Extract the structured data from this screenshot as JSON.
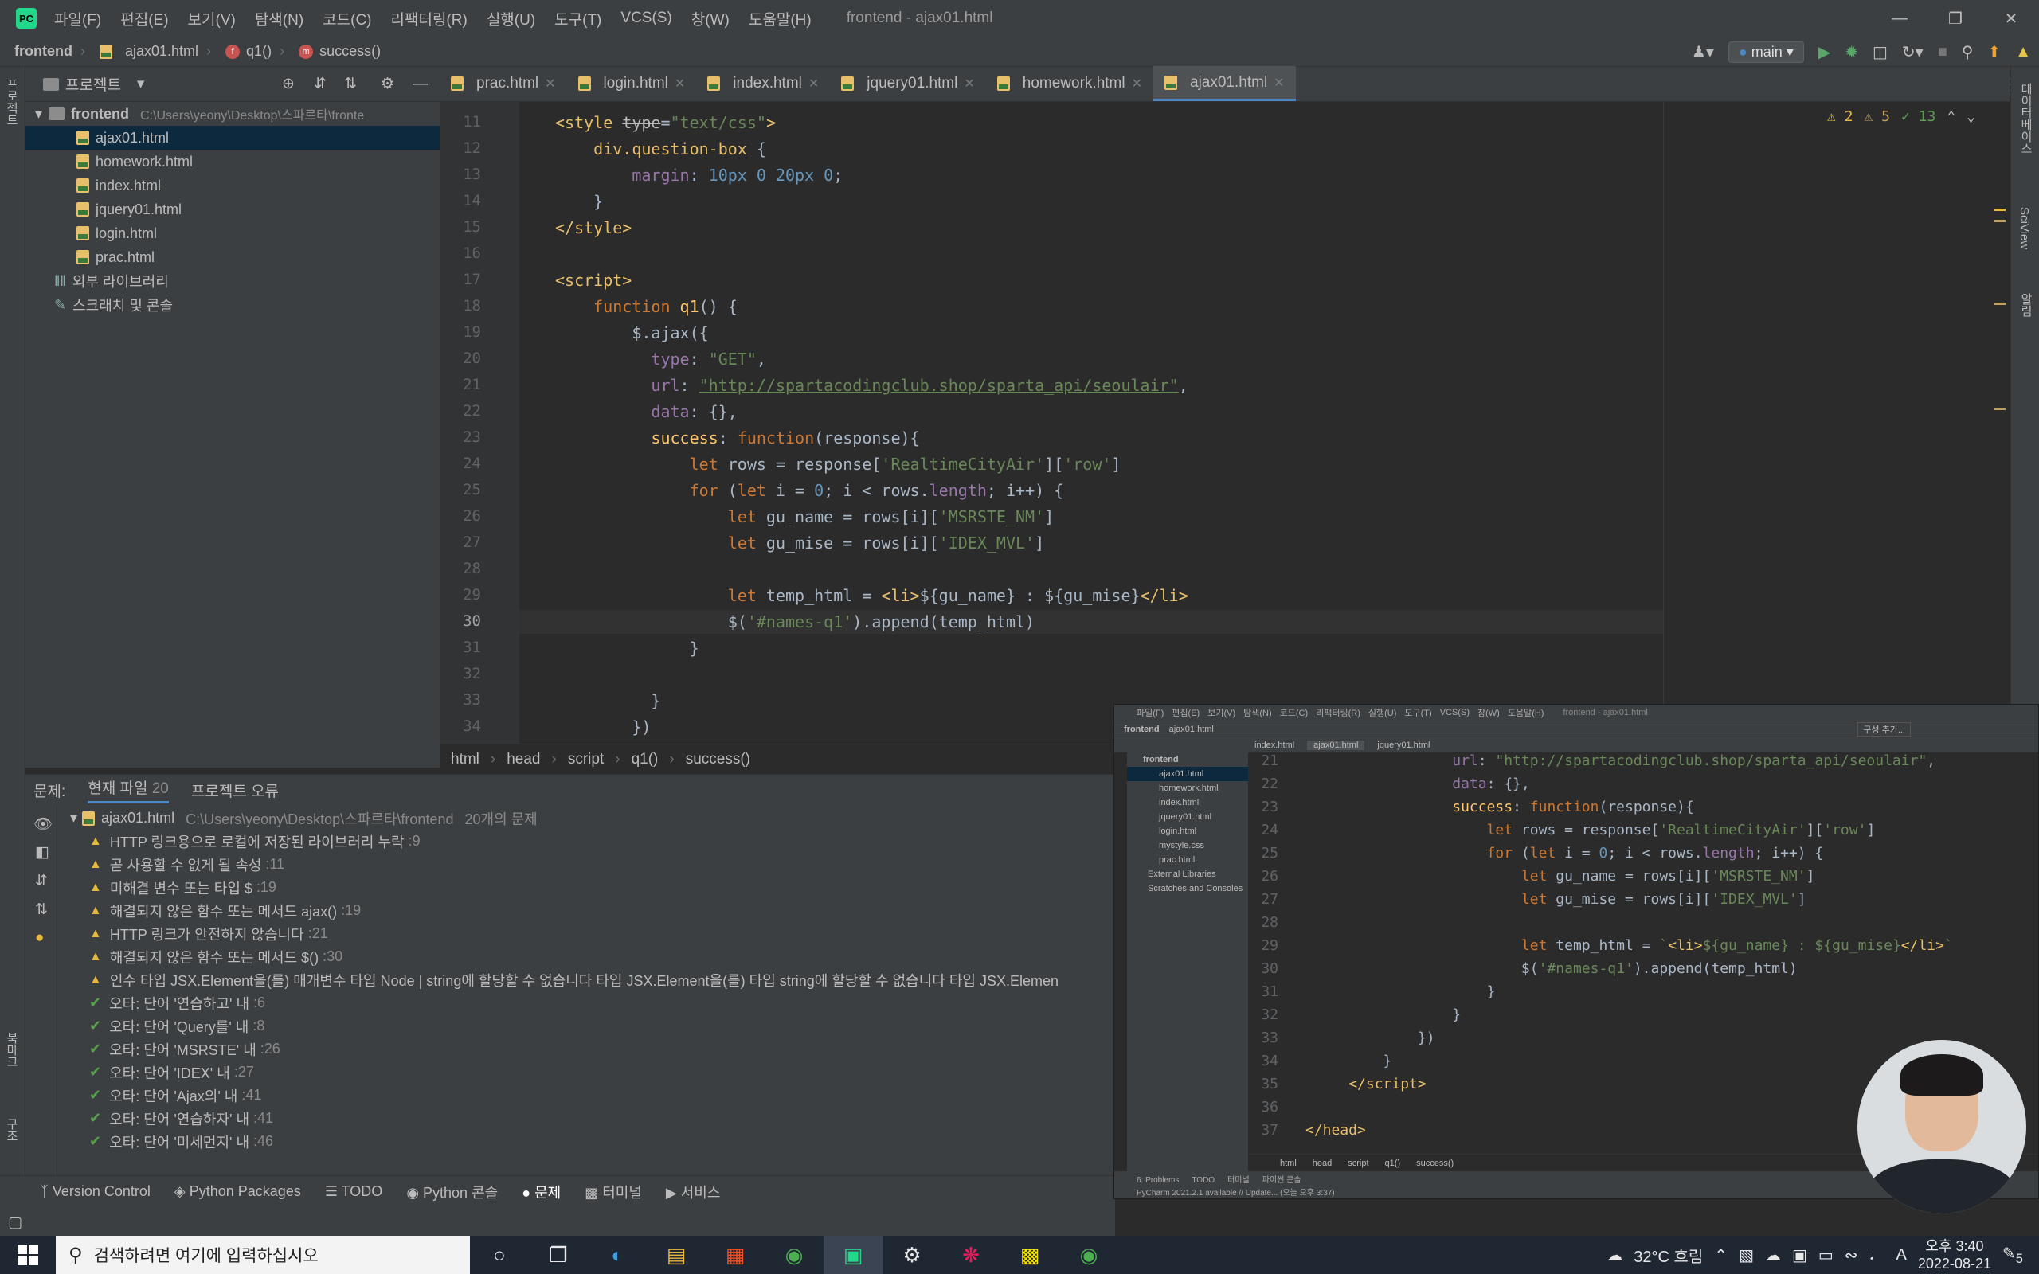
{
  "titlebar": {
    "menus": [
      "파일(F)",
      "편집(E)",
      "보기(V)",
      "탐색(N)",
      "코드(C)",
      "리팩터링(R)",
      "실행(U)",
      "도구(T)",
      "VCS(S)",
      "창(W)",
      "도움말(H)"
    ],
    "window_title": "frontend - ajax01.html",
    "app_logo": "PC"
  },
  "navbar": {
    "project": "frontend",
    "file": "ajax01.html",
    "fn1": "q1()",
    "fn2": "success()",
    "branch": "main"
  },
  "stripe": {
    "left_top": "프로젝트",
    "left_b1": "북마크",
    "left_b2": "구조",
    "right1": "데이터베이스",
    "right2": "SciView",
    "right3": "알림"
  },
  "project_panel": {
    "title": "프로젝트",
    "root": "frontend",
    "root_path": "C:\\Users\\yeony\\Desktop\\스파르타\\fronte",
    "files": [
      "ajax01.html",
      "homework.html",
      "index.html",
      "jquery01.html",
      "login.html",
      "prac.html"
    ],
    "ext_libs": "외부 라이브러리",
    "scratches": "스크래치 및 콘솔"
  },
  "tabs": [
    "prac.html",
    "login.html",
    "index.html",
    "jquery01.html",
    "homework.html",
    "ajax01.html"
  ],
  "editor": {
    "warnings": "2",
    "weak": "5",
    "typos": "13"
  },
  "breadcrumb": [
    "html",
    "head",
    "script",
    "q1()",
    "success()"
  ],
  "problems": {
    "label": "문제:",
    "tab_current": "현재 파일",
    "tab_current_count": "20",
    "tab_project": "프로젝트 오류",
    "file": "ajax01.html",
    "file_path": "C:\\Users\\yeony\\Desktop\\스파르타\\frontend",
    "file_count": "20개의 문제",
    "items": [
      {
        "t": "w",
        "text": "HTTP 링크용으로 로컬에 저장된 라이브러리 누락",
        "loc": ":9"
      },
      {
        "t": "w",
        "text": "곧 사용할 수 없게 될 속성",
        "loc": ":11"
      },
      {
        "t": "w",
        "text": "미해결 변수 또는 타입 $",
        "loc": ":19"
      },
      {
        "t": "w",
        "text": "해결되지 않은 함수 또는 메서드 ajax()",
        "loc": ":19"
      },
      {
        "t": "w",
        "text": "HTTP 링크가 안전하지 않습니다",
        "loc": ":21"
      },
      {
        "t": "w",
        "text": "해결되지 않은 함수 또는 메서드 $()",
        "loc": ":30"
      },
      {
        "t": "w",
        "text": "인수 타입 JSX.Element을(를) 매개변수 타입 Node | string에 할당할 수 없습니다  타입 JSX.Element을(를) 타입 string에 할당할 수 없습니다    타입 JSX.Elemen",
        "loc": ""
      },
      {
        "t": "t",
        "text": "오타: 단어 '연습하고' 내",
        "loc": ":6"
      },
      {
        "t": "t",
        "text": "오타: 단어 'Query를' 내",
        "loc": ":8"
      },
      {
        "t": "t",
        "text": "오타: 단어 'MSRSTE' 내",
        "loc": ":26"
      },
      {
        "t": "t",
        "text": "오타: 단어 'IDEX' 내",
        "loc": ":27"
      },
      {
        "t": "t",
        "text": "오타: 단어 'Ajax의' 내",
        "loc": ":41"
      },
      {
        "t": "t",
        "text": "오타: 단어 '연습하자' 내",
        "loc": ":41"
      },
      {
        "t": "t",
        "text": "오타: 단어 '미세먼지' 내",
        "loc": ":46"
      }
    ]
  },
  "bottom_bar": [
    "Version Control",
    "Python Packages",
    "TODO",
    "Python 콘솔",
    "문제",
    "터미널",
    "서비스"
  ],
  "pip": {
    "title": "frontend - ajax01.html",
    "nav_project": "frontend",
    "nav_file": "ajax01.html",
    "tabs": [
      "index.html",
      "ajax01.html",
      "jquery01.html"
    ],
    "tree": [
      "frontend",
      "ajax01.html",
      "homework.html",
      "index.html",
      "jquery01.html",
      "login.html",
      "mystyle.css",
      "prac.html",
      "External Libraries",
      "Scratches and Consoles"
    ],
    "breadcrumb": [
      "html",
      "head",
      "script",
      "q1()",
      "success()"
    ],
    "status": "PyCharm 2021.2.1 available // Update... (오늘 오후 3:37)",
    "bottom_tabs": [
      "6: Problems",
      "TODO",
      "터미널",
      "파이썬 콘솔"
    ],
    "run_config": "구성 추가..."
  },
  "taskbar": {
    "search": "검색하려면 여기에 입력하십시오",
    "weather": "32°C  흐림",
    "ime": "A",
    "time": "오후 3:40",
    "date": "2022-08-21",
    "notif": "5"
  }
}
